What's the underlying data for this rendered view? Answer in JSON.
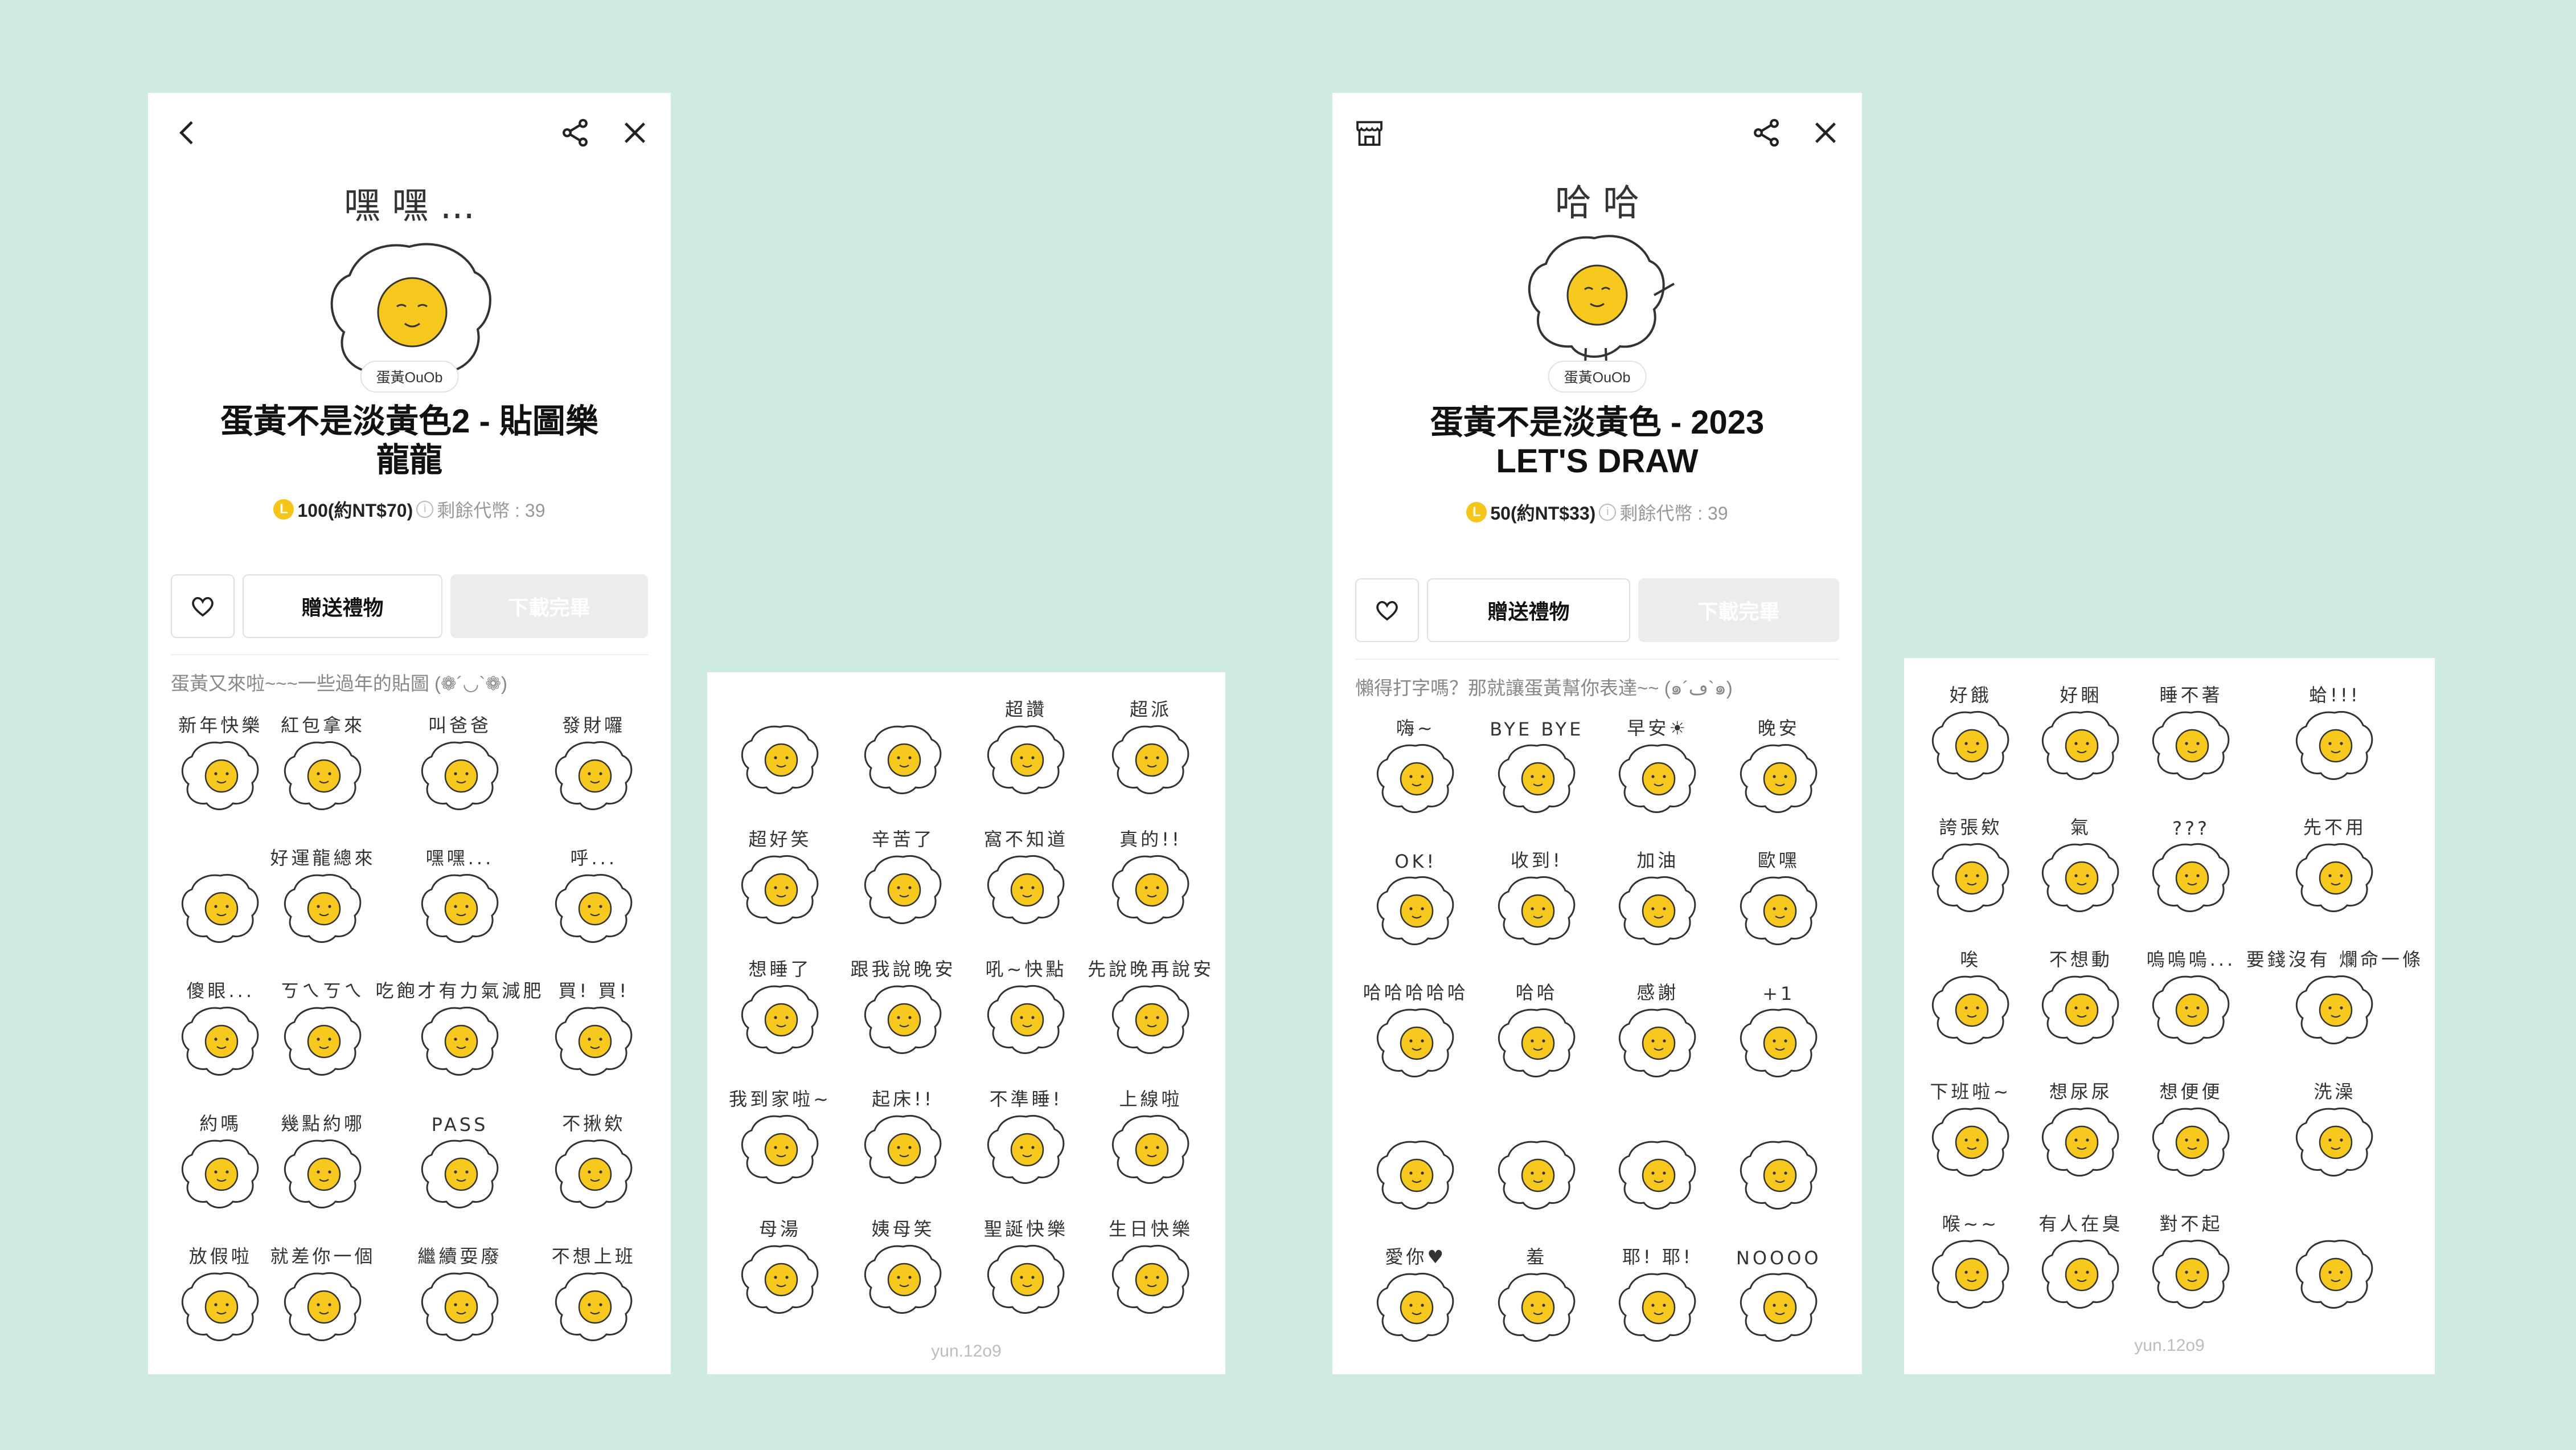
{
  "colors": {
    "background": "#cfeae0",
    "yolk": "#f7c81e",
    "coin": "#f5c518",
    "download_disabled": "#ececec"
  },
  "panel1": {
    "header": {
      "back_icon": "chevron-left-icon",
      "share_icon": "share-icon",
      "close_icon": "close-icon"
    },
    "hero_caption": "嘿 嘿 ...",
    "author": "蛋黃OuOb",
    "title_line1": "蛋黃不是淡黃色2 - 貼圖樂",
    "title_line2": "龍龍",
    "price": {
      "amount": "100(約NT$70)",
      "remaining": "剩餘代幣 : 39"
    },
    "buttons": {
      "gift": "贈送禮物",
      "download": "下載完畢"
    },
    "description": "蛋黃又來啦~~~一些過年的貼圖 (❁´◡`❁)",
    "stickers": [
      "新年快樂",
      "紅包拿來",
      "叫爸爸",
      "發財囉",
      "",
      "好運龍總來",
      "嘿嘿...",
      "呼...",
      "傻眼...",
      "ㄎㄟㄎㄟ",
      "吃飽才有力氣減肥",
      "買! 買!",
      "約嗎",
      "幾點約哪",
      "PASS",
      "不揪欸",
      "放假啦",
      "就差你一個",
      "繼續耍廢",
      "不想上班"
    ]
  },
  "panel2": {
    "stickers": [
      "",
      "",
      "超讚",
      "超派",
      "超好笑",
      "辛苦了",
      "窩不知道",
      "真的!!",
      "想睡了",
      "跟我說晚安",
      "吼~快點",
      "先說晚再說安",
      "我到家啦~",
      "起床!!",
      "不準睡!",
      "上線啦",
      "母湯",
      "姨母笑",
      "聖誕快樂",
      "生日快樂"
    ],
    "watermark": "yun.12o9"
  },
  "panel3": {
    "header": {
      "store_icon": "store-icon",
      "share_icon": "share-icon",
      "close_icon": "close-icon"
    },
    "hero_caption": "哈 哈",
    "author": "蛋黃OuOb",
    "title_line1": "蛋黃不是淡黃色 - 2023",
    "title_line2": "LET'S DRAW",
    "price": {
      "amount": "50(約NT$33)",
      "remaining": "剩餘代幣 : 39"
    },
    "buttons": {
      "gift": "贈送禮物",
      "download": "下載完畢"
    },
    "description": "懶得打字嗎？那就讓蛋黃幫你表達~~ (๑´ڡ`๑)",
    "stickers": [
      "嗨~",
      "BYE BYE",
      "早安☀",
      "晚安",
      "OK!",
      "收到!",
      "加油",
      "歐嘿",
      "哈哈哈哈哈",
      "哈哈",
      "感謝",
      "+1",
      "",
      "",
      "",
      "",
      "愛你♥",
      "羞",
      "耶! 耶!",
      "NOOOO"
    ]
  },
  "panel4": {
    "stickers": [
      "好餓",
      "好睏",
      "睡不著",
      "蛤!!!",
      "誇張欸",
      "氣",
      "???",
      "先不用",
      "唉",
      "不想動",
      "嗚嗚嗚...",
      "要錢沒有 爛命一條",
      "下班啦~",
      "想尿尿",
      "想便便",
      "洗澡",
      "喉~~",
      "有人在臭",
      "對不起",
      ""
    ],
    "watermark": "yun.12o9"
  }
}
